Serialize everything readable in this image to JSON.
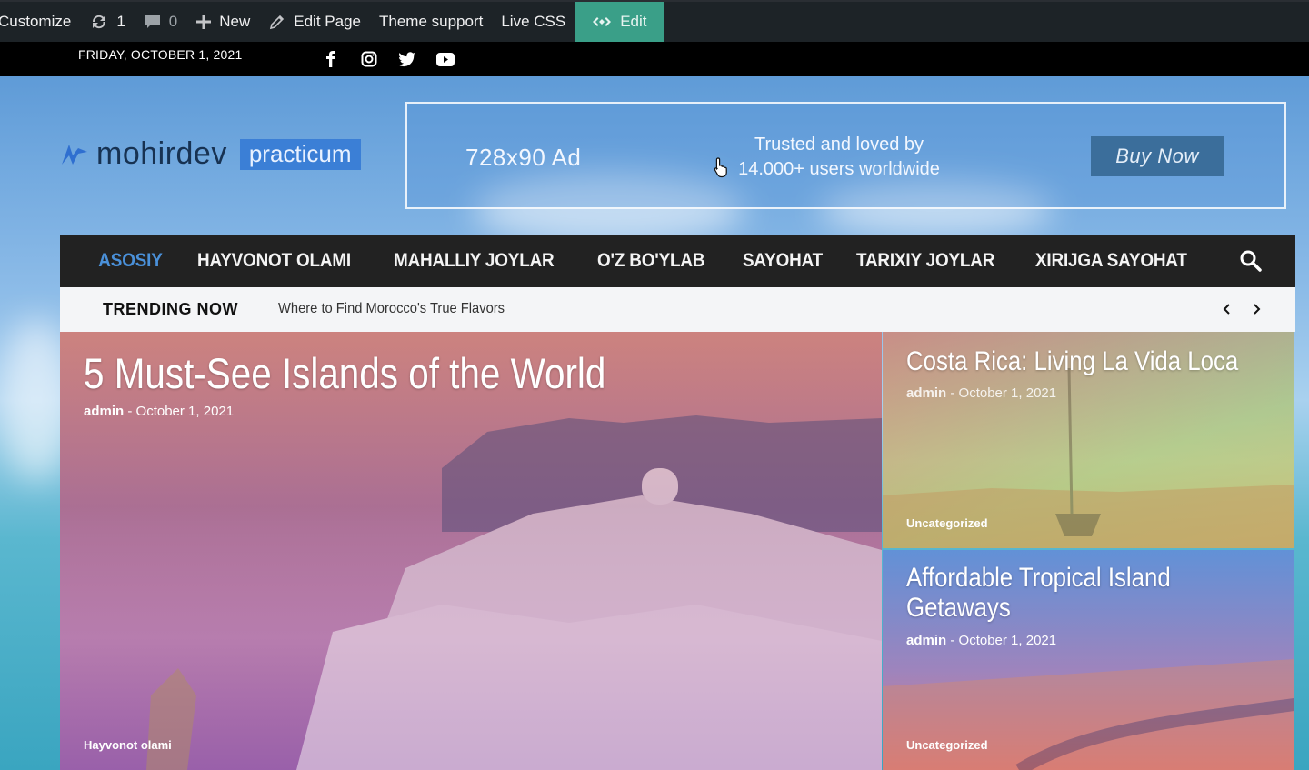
{
  "admin_bar": {
    "customize": "Customize",
    "updates_count": "1",
    "comments_count": "0",
    "new_label": "New",
    "edit_page": "Edit Page",
    "theme_support": "Theme support",
    "live_css": "Live CSS",
    "edit_label": "Edit",
    "edit_color": "#3a9f88"
  },
  "top_bar": {
    "date": "FRIDAY, OCTOBER 1, 2021",
    "social": [
      "facebook-icon",
      "instagram-icon",
      "twitter-icon",
      "youtube-icon"
    ]
  },
  "header": {
    "logo_text": "mohirdev",
    "logo_badge": "practicum",
    "ad": {
      "size_label": "728x90 Ad",
      "trust_line1": "Trusted and loved by",
      "trust_line2": "14.000+ users worldwide",
      "button": "Buy Now"
    }
  },
  "nav": {
    "items": [
      "ASOSIY",
      "HAYVONOT OLAMI",
      "MAHALLIY JOYLAR",
      "O'Z BO'YLAB",
      "SAYOHAT",
      "TARIXIY JOYLAR",
      "XIRIJGA SAYOHAT"
    ],
    "active_color": "#4a90d9"
  },
  "trending": {
    "label": "TRENDING NOW",
    "text": "Where to Find Morocco's True Flavors"
  },
  "posts": [
    {
      "title": "5 Must-See Islands of the World",
      "author": "admin",
      "date": "October 1, 2021",
      "category": "Hayvonot olami"
    },
    {
      "title": "Costa Rica: Living La Vida Loca",
      "author": "admin",
      "date": "October 1, 2021",
      "category": "Uncategorized"
    },
    {
      "title": "Affordable Tropical Island Getaways",
      "author": "admin",
      "date": "October 1, 2021",
      "category": "Uncategorized"
    }
  ]
}
